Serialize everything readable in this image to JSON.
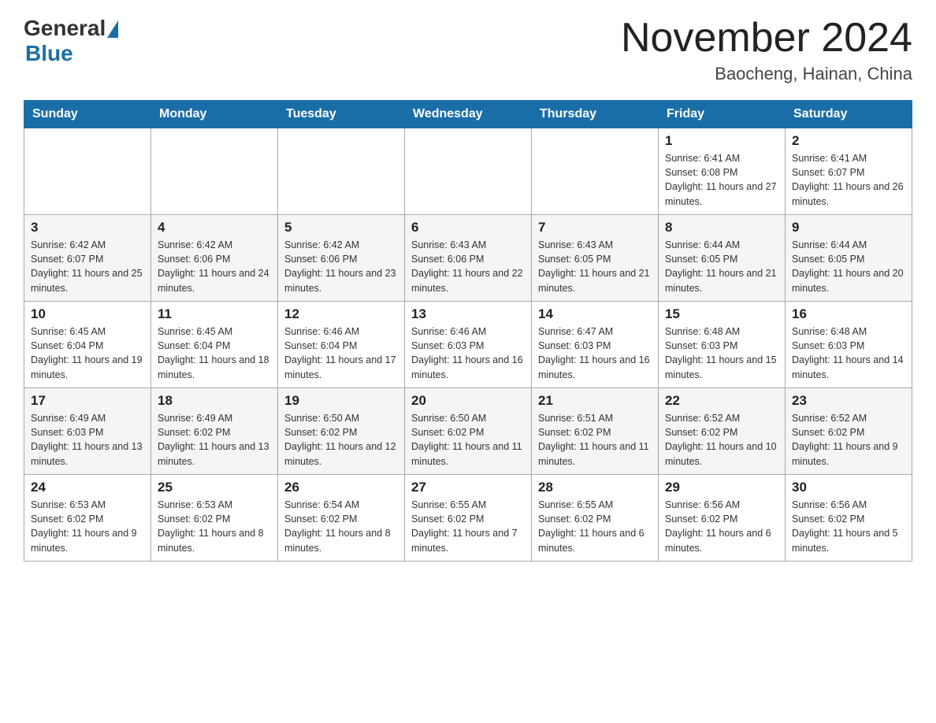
{
  "header": {
    "logo_general": "General",
    "logo_blue": "Blue",
    "month_title": "November 2024",
    "location": "Baocheng, Hainan, China"
  },
  "weekdays": [
    "Sunday",
    "Monday",
    "Tuesday",
    "Wednesday",
    "Thursday",
    "Friday",
    "Saturday"
  ],
  "weeks": [
    [
      {
        "day": "",
        "info": ""
      },
      {
        "day": "",
        "info": ""
      },
      {
        "day": "",
        "info": ""
      },
      {
        "day": "",
        "info": ""
      },
      {
        "day": "",
        "info": ""
      },
      {
        "day": "1",
        "info": "Sunrise: 6:41 AM\nSunset: 6:08 PM\nDaylight: 11 hours and 27 minutes."
      },
      {
        "day": "2",
        "info": "Sunrise: 6:41 AM\nSunset: 6:07 PM\nDaylight: 11 hours and 26 minutes."
      }
    ],
    [
      {
        "day": "3",
        "info": "Sunrise: 6:42 AM\nSunset: 6:07 PM\nDaylight: 11 hours and 25 minutes."
      },
      {
        "day": "4",
        "info": "Sunrise: 6:42 AM\nSunset: 6:06 PM\nDaylight: 11 hours and 24 minutes."
      },
      {
        "day": "5",
        "info": "Sunrise: 6:42 AM\nSunset: 6:06 PM\nDaylight: 11 hours and 23 minutes."
      },
      {
        "day": "6",
        "info": "Sunrise: 6:43 AM\nSunset: 6:06 PM\nDaylight: 11 hours and 22 minutes."
      },
      {
        "day": "7",
        "info": "Sunrise: 6:43 AM\nSunset: 6:05 PM\nDaylight: 11 hours and 21 minutes."
      },
      {
        "day": "8",
        "info": "Sunrise: 6:44 AM\nSunset: 6:05 PM\nDaylight: 11 hours and 21 minutes."
      },
      {
        "day": "9",
        "info": "Sunrise: 6:44 AM\nSunset: 6:05 PM\nDaylight: 11 hours and 20 minutes."
      }
    ],
    [
      {
        "day": "10",
        "info": "Sunrise: 6:45 AM\nSunset: 6:04 PM\nDaylight: 11 hours and 19 minutes."
      },
      {
        "day": "11",
        "info": "Sunrise: 6:45 AM\nSunset: 6:04 PM\nDaylight: 11 hours and 18 minutes."
      },
      {
        "day": "12",
        "info": "Sunrise: 6:46 AM\nSunset: 6:04 PM\nDaylight: 11 hours and 17 minutes."
      },
      {
        "day": "13",
        "info": "Sunrise: 6:46 AM\nSunset: 6:03 PM\nDaylight: 11 hours and 16 minutes."
      },
      {
        "day": "14",
        "info": "Sunrise: 6:47 AM\nSunset: 6:03 PM\nDaylight: 11 hours and 16 minutes."
      },
      {
        "day": "15",
        "info": "Sunrise: 6:48 AM\nSunset: 6:03 PM\nDaylight: 11 hours and 15 minutes."
      },
      {
        "day": "16",
        "info": "Sunrise: 6:48 AM\nSunset: 6:03 PM\nDaylight: 11 hours and 14 minutes."
      }
    ],
    [
      {
        "day": "17",
        "info": "Sunrise: 6:49 AM\nSunset: 6:03 PM\nDaylight: 11 hours and 13 minutes."
      },
      {
        "day": "18",
        "info": "Sunrise: 6:49 AM\nSunset: 6:02 PM\nDaylight: 11 hours and 13 minutes."
      },
      {
        "day": "19",
        "info": "Sunrise: 6:50 AM\nSunset: 6:02 PM\nDaylight: 11 hours and 12 minutes."
      },
      {
        "day": "20",
        "info": "Sunrise: 6:50 AM\nSunset: 6:02 PM\nDaylight: 11 hours and 11 minutes."
      },
      {
        "day": "21",
        "info": "Sunrise: 6:51 AM\nSunset: 6:02 PM\nDaylight: 11 hours and 11 minutes."
      },
      {
        "day": "22",
        "info": "Sunrise: 6:52 AM\nSunset: 6:02 PM\nDaylight: 11 hours and 10 minutes."
      },
      {
        "day": "23",
        "info": "Sunrise: 6:52 AM\nSunset: 6:02 PM\nDaylight: 11 hours and 9 minutes."
      }
    ],
    [
      {
        "day": "24",
        "info": "Sunrise: 6:53 AM\nSunset: 6:02 PM\nDaylight: 11 hours and 9 minutes."
      },
      {
        "day": "25",
        "info": "Sunrise: 6:53 AM\nSunset: 6:02 PM\nDaylight: 11 hours and 8 minutes."
      },
      {
        "day": "26",
        "info": "Sunrise: 6:54 AM\nSunset: 6:02 PM\nDaylight: 11 hours and 8 minutes."
      },
      {
        "day": "27",
        "info": "Sunrise: 6:55 AM\nSunset: 6:02 PM\nDaylight: 11 hours and 7 minutes."
      },
      {
        "day": "28",
        "info": "Sunrise: 6:55 AM\nSunset: 6:02 PM\nDaylight: 11 hours and 6 minutes."
      },
      {
        "day": "29",
        "info": "Sunrise: 6:56 AM\nSunset: 6:02 PM\nDaylight: 11 hours and 6 minutes."
      },
      {
        "day": "30",
        "info": "Sunrise: 6:56 AM\nSunset: 6:02 PM\nDaylight: 11 hours and 5 minutes."
      }
    ]
  ]
}
